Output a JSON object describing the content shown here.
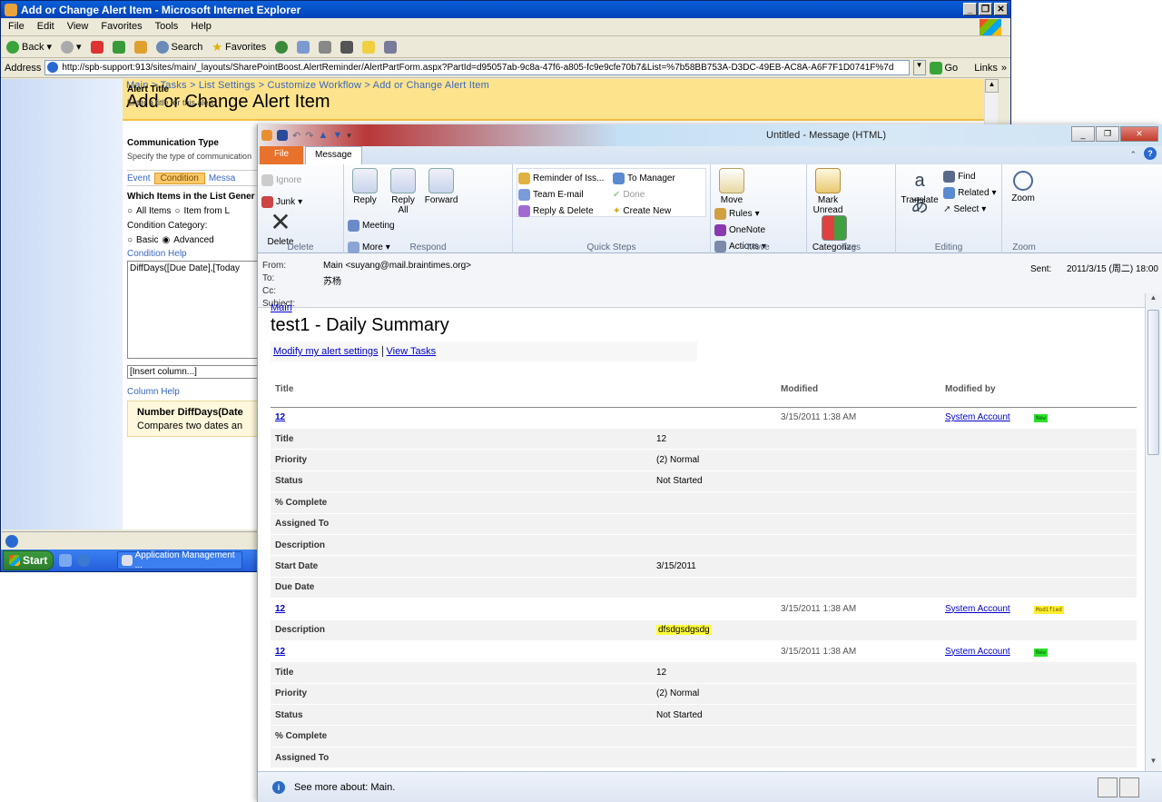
{
  "ie": {
    "title": "Add or Change Alert Item - Microsoft Internet Explorer",
    "menu": [
      "File",
      "Edit",
      "View",
      "Favorites",
      "Tools",
      "Help"
    ],
    "toolbar": {
      "back": "Back",
      "search": "Search",
      "favorites": "Favorites"
    },
    "address_label": "Address",
    "url": "http://spb-support:913/sites/main/_layouts/SharePointBoost.AlertReminder/AlertPartForm.aspx?PartId=d95057ab-9c8a-47f6-a805-fc9e9cfe70b7&List=%7b58BB753A-D3DC-49EB-AC8A-A6F7F1D0741F%7d",
    "go": "Go",
    "links": "Links"
  },
  "sp": {
    "breadcrumb": "Main > Tasks > List Settings > Customize Workflow > Add or Change Alert Item",
    "title": "Add or Change Alert Item",
    "alert_title_h": "Alert Title",
    "alert_title_d": "Enter a title for this alert.",
    "comm_type_h": "Communication Type",
    "comm_type_d": "Specify the type of communication",
    "tabs": [
      "Event",
      "Condition",
      "Messa"
    ],
    "which_items": "Which Items in the List Gener",
    "opt_all": "All Items",
    "opt_from": "Item from L",
    "cond_cat": "Condition Category:",
    "opt_basic": "Basic",
    "opt_adv": "Advanced",
    "cond_help": "Condition Help",
    "formula": "DiffDays([Due Date],[Today",
    "insert_col": "[Insert column...]",
    "col_help": "Column Help",
    "fn_title": "Number DiffDays(Date",
    "fn_desc": "Compares two dates an"
  },
  "taskbar": {
    "start": "Start",
    "app": "Application Management ..."
  },
  "outlook": {
    "title": "Untitled - Message (HTML)",
    "tab_file": "File",
    "tab_message": "Message",
    "delete_group": {
      "ignore": "Ignore",
      "junk": "Junk",
      "delete": "Delete",
      "label": "Delete"
    },
    "respond_group": {
      "reply": "Reply",
      "reply_all": "Reply All",
      "forward": "Forward",
      "meeting": "Meeting",
      "more": "More",
      "label": "Respond"
    },
    "quick_steps": {
      "items": [
        "Reminder of Iss...",
        "To Manager",
        "Team E-mail",
        "Done",
        "Reply & Delete",
        "Create New"
      ],
      "label": "Quick Steps"
    },
    "move_group": {
      "move": "Move",
      "rules": "Rules",
      "onenote": "OneNote",
      "actions": "Actions",
      "label": "Move"
    },
    "tags_group": {
      "mark_unread": "Mark Unread",
      "categorize": "Categorize",
      "label": "Tags"
    },
    "editing_group": {
      "translate": "Translate",
      "find": "Find",
      "related": "Related",
      "select": "Select",
      "label": "Editing"
    },
    "zoom_group": {
      "zoom": "Zoom",
      "label": "Zoom"
    },
    "header": {
      "from_k": "From:",
      "from_v": "Main <suyang@mail.braintimes.org>",
      "to_k": "To:",
      "to_v": "苏杨",
      "cc_k": "Cc:",
      "subject_k": "Subject:",
      "sent_k": "Sent:",
      "sent_v": "2011/3/15 (周二) 18:00"
    },
    "footer": "See more about: Main."
  },
  "mail": {
    "site_link": "Main",
    "title": "test1 - Daily Summary",
    "modify_link": "Modify my alert settings",
    "view_link": "View Tasks",
    "col_title": "Title",
    "col_modified": "Modified",
    "col_by": "Modified by",
    "items": [
      {
        "id": "12",
        "modified": "3/15/2011 1:38 AM",
        "by": "System Account",
        "badge": "New",
        "fields": [
          [
            "Title",
            "12"
          ],
          [
            "Priority",
            "(2) Normal"
          ],
          [
            "Status",
            "Not Started"
          ],
          [
            "% Complete",
            ""
          ],
          [
            "Assigned To",
            ""
          ],
          [
            "Description",
            ""
          ],
          [
            "Start Date",
            "3/15/2011"
          ],
          [
            "Due Date",
            ""
          ]
        ]
      },
      {
        "id": "12",
        "modified": "3/15/2011 1:38 AM",
        "by": "System Account",
        "badge": "Modified",
        "fields": [
          [
            "Description",
            "dfsdgsdgsdg"
          ]
        ]
      },
      {
        "id": "12",
        "modified": "3/15/2011 1:38 AM",
        "by": "System Account",
        "badge": "New",
        "fields": [
          [
            "Title",
            "12"
          ],
          [
            "Priority",
            "(2) Normal"
          ],
          [
            "Status",
            "Not Started"
          ],
          [
            "% Complete",
            ""
          ],
          [
            "Assigned To",
            ""
          ]
        ]
      }
    ]
  },
  "colors": {
    "xp_blue": "#0a5fd8",
    "sp_header": "#fde38c",
    "outlook_file": "#e8722c",
    "new_badge": "#2be02b",
    "modified_badge": "#ffef2e"
  }
}
